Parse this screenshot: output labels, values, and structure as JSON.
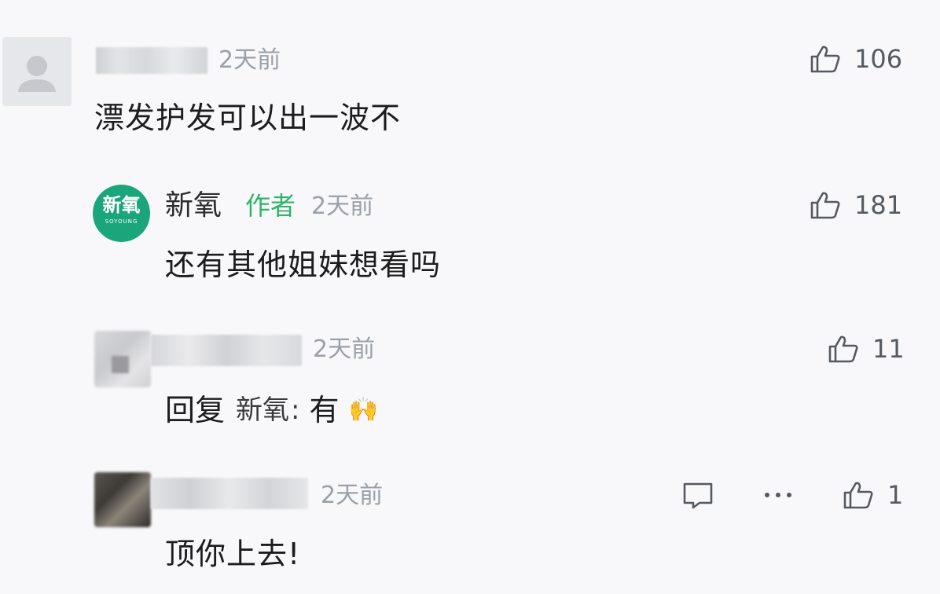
{
  "comments": [
    {
      "time": "2天前",
      "text": "漂发护发可以出一波不",
      "likes": "106",
      "replies": [
        {
          "author": "新氧",
          "author_badge": "作者",
          "time": "2天前",
          "text": "还有其他姐妹想看吗",
          "likes": "181",
          "avatar_text": "新氧",
          "avatar_subtext": "SOYOUNG"
        },
        {
          "time": "2天前",
          "reply_prefix": "回复",
          "reply_to": "新氧",
          "reply_sep": ":",
          "text": "有",
          "likes": "11",
          "emoji": "🙌"
        },
        {
          "time": "2天前",
          "text": "顶你上去!",
          "likes": "1"
        }
      ]
    }
  ],
  "colors": {
    "author_badge": "#2fb36a",
    "brand_avatar": "#1aa57a",
    "muted": "#9aa0a8"
  },
  "icons": [
    "default-avatar-icon",
    "thumbs-up-icon",
    "comment-icon",
    "more-icon"
  ]
}
